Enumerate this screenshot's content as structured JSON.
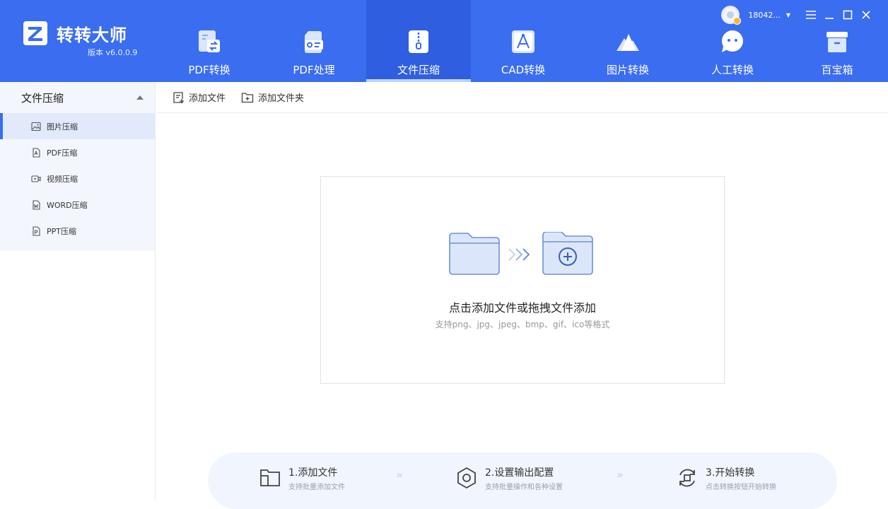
{
  "app": {
    "name": "转转大师",
    "version": "版本 v6.0.0.9",
    "username": "18042..."
  },
  "nav": {
    "tabs": [
      {
        "label": "PDF转换",
        "icon": "pdf-convert-icon"
      },
      {
        "label": "PDF处理",
        "icon": "pdf-process-icon"
      },
      {
        "label": "文件压缩",
        "icon": "zip-icon",
        "active": true
      },
      {
        "label": "CAD转换",
        "icon": "cad-icon"
      },
      {
        "label": "图片转换",
        "icon": "image-convert-icon"
      },
      {
        "label": "人工转换",
        "icon": "chat-icon"
      },
      {
        "label": "百宝箱",
        "icon": "toolbox-icon"
      }
    ]
  },
  "sidebar": {
    "group_title": "文件压缩",
    "items": [
      {
        "label": "图片压缩",
        "icon": "image-icon",
        "active": true
      },
      {
        "label": "PDF压缩",
        "icon": "pdf-file-icon"
      },
      {
        "label": "视频压缩",
        "icon": "video-icon"
      },
      {
        "label": "WORD压缩",
        "icon": "word-file-icon"
      },
      {
        "label": "PPT压缩",
        "icon": "ppt-file-icon"
      }
    ]
  },
  "toolbar": {
    "add_file": "添加文件",
    "add_folder": "添加文件夹"
  },
  "dropzone": {
    "title": "点击添加文件或拖拽文件添加",
    "subtitle": "支持png、jpg、jpeg、bmp、gif、ico等格式"
  },
  "steps": [
    {
      "title": "1.添加文件",
      "sub": "支持批量添加文件",
      "icon": "folder-step-icon"
    },
    {
      "title": "2.设置输出配置",
      "sub": "支持批量操作和各种设置",
      "icon": "settings-step-icon"
    },
    {
      "title": "3.开始转换",
      "sub": "点击转换按钮开始转换",
      "icon": "convert-step-icon"
    }
  ],
  "colors": {
    "brand": "#3a6df0",
    "brand_active": "#2f5fe0",
    "sidebar_bg": "#f3f6fc",
    "sidebar_active": "#e1e9fb"
  }
}
